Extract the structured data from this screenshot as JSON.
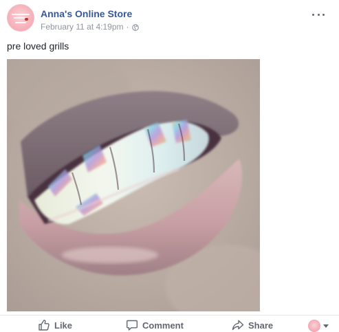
{
  "post": {
    "author": "Anna's Online Store",
    "timestamp": "February 11 at 4:19pm",
    "separator": "·",
    "privacy_icon": "globe-icon",
    "text": "pre loved grills",
    "photo_subject": "smiling mouth wearing iridescent tooth grills",
    "more_icon": "more-options-icon"
  },
  "actions": {
    "like_label": "Like",
    "comment_label": "Comment",
    "share_label": "Share"
  },
  "colors": {
    "link": "#365899",
    "meta": "#90949c",
    "action": "#606770",
    "avatar_pink": "#f6b2bb"
  }
}
